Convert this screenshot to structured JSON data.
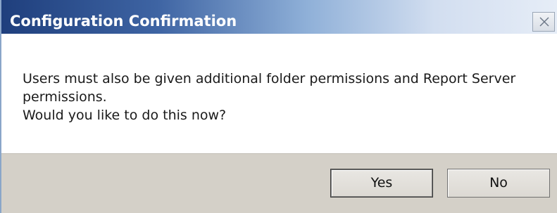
{
  "window": {
    "title": "Configuration Confirmation",
    "close_icon": "close-icon"
  },
  "message": {
    "line1": "Users must also be given additional folder permissions and Report Server",
    "line2": "permissions.",
    "line3": "Would you like to do this now?"
  },
  "buttons": {
    "yes_label": "Yes",
    "no_label": "No"
  },
  "colors": {
    "title_bar_start": "#1f3f7d",
    "title_bar_end": "#e6edf7",
    "footer_background": "#d4d0c8"
  }
}
